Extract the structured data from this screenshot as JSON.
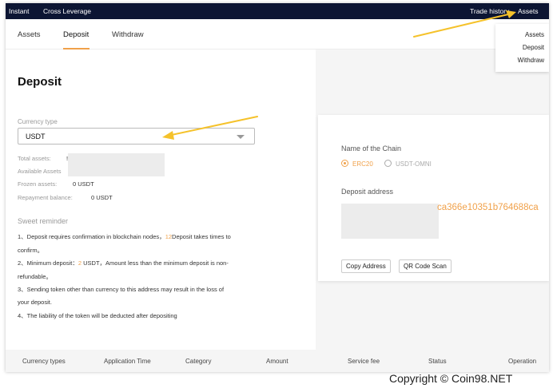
{
  "nav": {
    "left_items": [
      "Instant",
      "Cross Leverage"
    ],
    "right_items": [
      "Trade history",
      "Assets"
    ]
  },
  "tabs": [
    "Assets",
    "Deposit",
    "Withdraw"
  ],
  "active_tab": "Deposit",
  "dropdown_items": [
    "Assets",
    "Deposit",
    "Withdraw"
  ],
  "page_title": "Deposit",
  "currency": {
    "label": "Currency type",
    "selected": "USDT"
  },
  "balances": {
    "total_assets_label": "Total assets:",
    "total_assets_value": "!",
    "available_label": "Available Assets",
    "frozen_label": "Frozen assets:",
    "frozen_value": "0 USDT",
    "repayment_label": "Repayment balance:",
    "repayment_value": "0 USDT"
  },
  "reminder": {
    "title": "Sweet reminder",
    "line1_a": "1、Deposit requires confirmation in blockchain nodes，",
    "line1_hl": "12",
    "line1_b": "Deposit takes times to",
    "line1_c": "confirm。",
    "line2_a": "2、Minimum deposit：",
    "line2_hl": "2",
    "line2_b": " USDT，Amount less than the minimum deposit is non-",
    "line2_c": "refundable。",
    "line3_a": "3、Sending token other than currency to this address may result in the loss of",
    "line3_b": "your deposit.",
    "line4": "4、The liability of the token will be deducted after depositing"
  },
  "chain": {
    "label": "Name of the Chain",
    "options": [
      "ERC20",
      "USDT-OMNI"
    ],
    "selected": "ERC20"
  },
  "deposit_address": {
    "label": "Deposit address",
    "visible_fragment": "ca366e10351b764688ca"
  },
  "buttons": {
    "copy": "Copy Address",
    "qr": "QR Code Scan"
  },
  "table_headers": [
    "Currency types",
    "Application Time",
    "Category",
    "Amount",
    "Service fee",
    "Status",
    "Operation"
  ],
  "watermark": "Copyright © Coin98.NET",
  "colors": {
    "accent": "#f0a14a",
    "nav_bg": "#0c1533",
    "arrow": "#f5c22b"
  }
}
